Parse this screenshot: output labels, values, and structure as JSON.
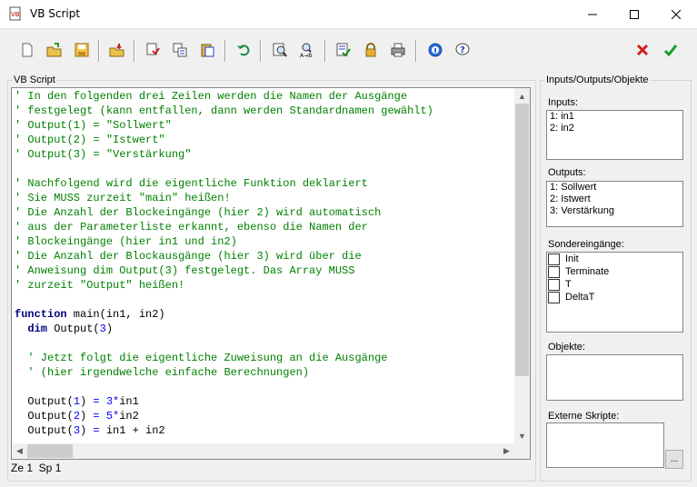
{
  "window": {
    "title": "VB Script"
  },
  "toolbar": {
    "icons": [
      "new-file-icon",
      "open-file-icon",
      "save-icon",
      "import-icon",
      "test-icon",
      "variables-icon",
      "paste-block-icon",
      "undo-icon",
      "search-icon",
      "replace-icon",
      "check-icon",
      "lock-icon",
      "print-icon",
      "info-icon",
      "help-icon",
      "cancel-icon",
      "ok-icon"
    ]
  },
  "editor": {
    "group_label": "VB Script",
    "lines": [
      [
        {
          "t": "' In den folgenden drei Zeilen werden die Namen der Ausgänge",
          "c": "com"
        }
      ],
      [
        {
          "t": "' festgelegt (kann entfallen, dann werden Standardnamen gewählt)",
          "c": "com"
        }
      ],
      [
        {
          "t": "' Output(1) = \"Sollwert\"",
          "c": "com"
        }
      ],
      [
        {
          "t": "' Output(2) = \"Istwert\"",
          "c": "com"
        }
      ],
      [
        {
          "t": "' Output(3) = \"Verstärkung\"",
          "c": "com"
        }
      ],
      [],
      [
        {
          "t": "' Nachfolgend wird die eigentliche Funktion deklariert",
          "c": "com"
        }
      ],
      [
        {
          "t": "' Sie MUSS zurzeit \"main\" heißen!",
          "c": "com"
        }
      ],
      [
        {
          "t": "' Die Anzahl der Blockeingänge (hier 2) wird automatisch",
          "c": "com"
        }
      ],
      [
        {
          "t": "' aus der Parameterliste erkannt, ebenso die Namen der",
          "c": "com"
        }
      ],
      [
        {
          "t": "' Blockeingänge (hier in1 und in2)",
          "c": "com"
        }
      ],
      [
        {
          "t": "' Die Anzahl der Blockausgänge (hier 3) wird über die",
          "c": "com"
        }
      ],
      [
        {
          "t": "' Anweisung dim Output(3) festgelegt. Das Array MUSS",
          "c": "com"
        }
      ],
      [
        {
          "t": "' zurzeit \"Output\" heißen!",
          "c": "com"
        }
      ],
      [],
      [
        {
          "t": "function",
          "c": "kw"
        },
        {
          "t": " main(in1, in2)",
          "c": ""
        }
      ],
      [
        {
          "t": "  ",
          "c": ""
        },
        {
          "t": "dim",
          "c": "kw"
        },
        {
          "t": " Output(",
          "c": ""
        },
        {
          "t": "3",
          "c": "num"
        },
        {
          "t": ")",
          "c": ""
        }
      ],
      [],
      [
        {
          "t": "  ' Jetzt folgt die eigentliche Zuweisung an die Ausgänge",
          "c": "com"
        }
      ],
      [
        {
          "t": "  ' (hier irgendwelche einfache Berechnungen)",
          "c": "com"
        }
      ],
      [],
      [
        {
          "t": "  Output(",
          "c": ""
        },
        {
          "t": "1",
          "c": "num"
        },
        {
          "t": ") ",
          "c": ""
        },
        {
          "t": "=",
          "c": "op"
        },
        {
          "t": " ",
          "c": ""
        },
        {
          "t": "3",
          "c": "num"
        },
        {
          "t": "*",
          "c": "op"
        },
        {
          "t": "in1",
          "c": ""
        }
      ],
      [
        {
          "t": "  Output(",
          "c": ""
        },
        {
          "t": "2",
          "c": "num"
        },
        {
          "t": ") ",
          "c": ""
        },
        {
          "t": "=",
          "c": "op"
        },
        {
          "t": " ",
          "c": ""
        },
        {
          "t": "5",
          "c": "num"
        },
        {
          "t": "*",
          "c": "op"
        },
        {
          "t": "in2",
          "c": ""
        }
      ],
      [
        {
          "t": "  Output(",
          "c": ""
        },
        {
          "t": "3",
          "c": "num"
        },
        {
          "t": ") ",
          "c": ""
        },
        {
          "t": "=",
          "c": "op"
        },
        {
          "t": " in1 + in2",
          "c": ""
        }
      ]
    ]
  },
  "status": {
    "position": "Ze 1  Sp 1"
  },
  "side": {
    "group_label": "Inputs/Outputs/Objekte",
    "inputs_label": "Inputs:",
    "inputs": [
      "1: in1",
      "2: in2"
    ],
    "outputs_label": "Outputs:",
    "outputs": [
      "1: Sollwert",
      "2: Istwert",
      "3: Verstärkung"
    ],
    "special_label": "Sondereingänge:",
    "special": [
      "Init",
      "Terminate",
      "T",
      "DeltaT"
    ],
    "objects_label": "Objekte:",
    "scripts_label": "Externe Skripte:",
    "browse_label": "..."
  }
}
